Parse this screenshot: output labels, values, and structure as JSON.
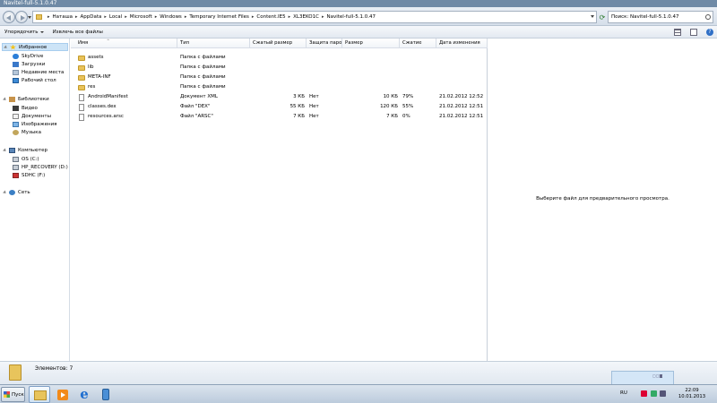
{
  "window": {
    "title": "Navitel-full-5.1.0.47"
  },
  "address": {
    "crumbs": [
      "Наташа",
      "AppData",
      "Local",
      "Microsoft",
      "Windows",
      "Temporary Internet Files",
      "Content.IE5",
      "XL3EKO1C",
      "Navitel-full-5.1.0.47"
    ],
    "separator": "▸"
  },
  "search": {
    "text": "Поиск: Navitel-full-5.1.0.47"
  },
  "toolbar": {
    "organize": "Упорядочить",
    "extract_all": "Извлечь все файлы"
  },
  "nav": {
    "favorites": "Избранное",
    "skydrive": "SkyDrive",
    "downloads": "Загрузки",
    "recent": "Недавние места",
    "desktop": "Рабочий стол",
    "libraries": "Библиотеки",
    "video": "Видео",
    "documents": "Документы",
    "images": "Изображения",
    "music": "Музыка",
    "computer": "Компьютер",
    "drive_c": "OS (C:)",
    "drive_d": "HP_RECOVERY (D:)",
    "drive_f": "SDHC (F:)",
    "network": "Сеть"
  },
  "columns": {
    "name": "Имя",
    "type": "Тип",
    "compressed": "Сжатый размер",
    "protected": "Защита пароль",
    "size": "Размер",
    "ratio": "Сжатие",
    "date": "Дата изменения",
    "sort_arrow": "^"
  },
  "files": [
    {
      "name": "assets",
      "type": "Папка с файлами",
      "compressed": "",
      "protected": "",
      "size": "",
      "ratio": "",
      "date": "",
      "kind": "folder"
    },
    {
      "name": "lib",
      "type": "Папка с файлами",
      "compressed": "",
      "protected": "",
      "size": "",
      "ratio": "",
      "date": "",
      "kind": "folder"
    },
    {
      "name": "META-INF",
      "type": "Папка с файлами",
      "compressed": "",
      "protected": "",
      "size": "",
      "ratio": "",
      "date": "",
      "kind": "folder"
    },
    {
      "name": "res",
      "type": "Папка с файлами",
      "compressed": "",
      "protected": "",
      "size": "",
      "ratio": "",
      "date": "",
      "kind": "folder"
    },
    {
      "name": "AndroidManifest",
      "type": "Документ XML",
      "compressed": "3 КБ",
      "protected": "Нет",
      "size": "10 КБ",
      "ratio": "79%",
      "date": "21.02.2012 12:52",
      "kind": "file"
    },
    {
      "name": "classes.dex",
      "type": "Файл \"DEX\"",
      "compressed": "55 КБ",
      "protected": "Нет",
      "size": "120 КБ",
      "ratio": "55%",
      "date": "21.02.2012 12:51",
      "kind": "file"
    },
    {
      "name": "resources.arsc",
      "type": "Файл \"ARSC\"",
      "compressed": "7 КБ",
      "protected": "Нет",
      "size": "7 КБ",
      "ratio": "0%",
      "date": "21.02.2012 12:51",
      "kind": "file"
    }
  ],
  "preview": {
    "message": "Выберите файл для предварительного просмотра."
  },
  "details": {
    "count_text": "Элементов: 7"
  },
  "taskbar": {
    "start": "Пуск",
    "ie_glyph": "e",
    "lang": "RU",
    "time": "22:09",
    "date": "10.01.2013"
  }
}
